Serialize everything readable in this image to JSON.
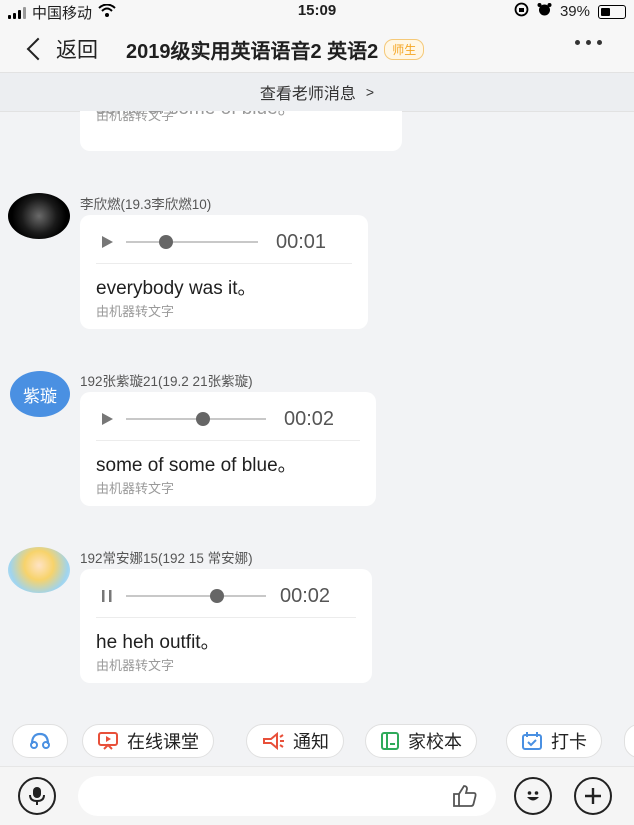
{
  "status_bar": {
    "carrier": "中国移动",
    "time": "15:09",
    "battery": "39%"
  },
  "nav": {
    "back_label": "返回",
    "title": "2019级实用英语语音2 英语2",
    "role_tag": "师生"
  },
  "notice": {
    "label": "查看老师消息",
    "arrow": ">"
  },
  "messages": [
    {
      "partial": true,
      "text": "some of some of blue。",
      "caption": "由机器转文字"
    },
    {
      "sender": "李欣燃(19.3李欣燃10)",
      "duration": "00:01",
      "progress": 0.3,
      "state": "paused",
      "text": "everybody was it。",
      "caption": "由机器转文字"
    },
    {
      "sender": "192张紫璇21(19.2  21张紫璇)",
      "avatar_text": "紫璇",
      "duration": "00:02",
      "progress": 0.55,
      "state": "paused",
      "text": "some of some of blue。",
      "caption": "由机器转文字"
    },
    {
      "sender": "192常安娜15(192  15  常安娜)",
      "duration": "00:02",
      "progress": 0.65,
      "state": "playing",
      "text": "he heh outfit。",
      "caption": "由机器转文字"
    }
  ],
  "shortcuts": [
    {
      "icon": "headset-icon",
      "label": ""
    },
    {
      "icon": "classroom-icon",
      "label": "在线课堂"
    },
    {
      "icon": "megaphone-icon",
      "label": "通知"
    },
    {
      "icon": "notebook-icon",
      "label": "家校本"
    },
    {
      "icon": "checkin-icon",
      "label": "打卡"
    }
  ],
  "colors": {
    "accent_blue": "#4a90e2",
    "tag_orange": "#f5a623",
    "red_icon": "#e8503a",
    "green_icon": "#2faa5a"
  }
}
